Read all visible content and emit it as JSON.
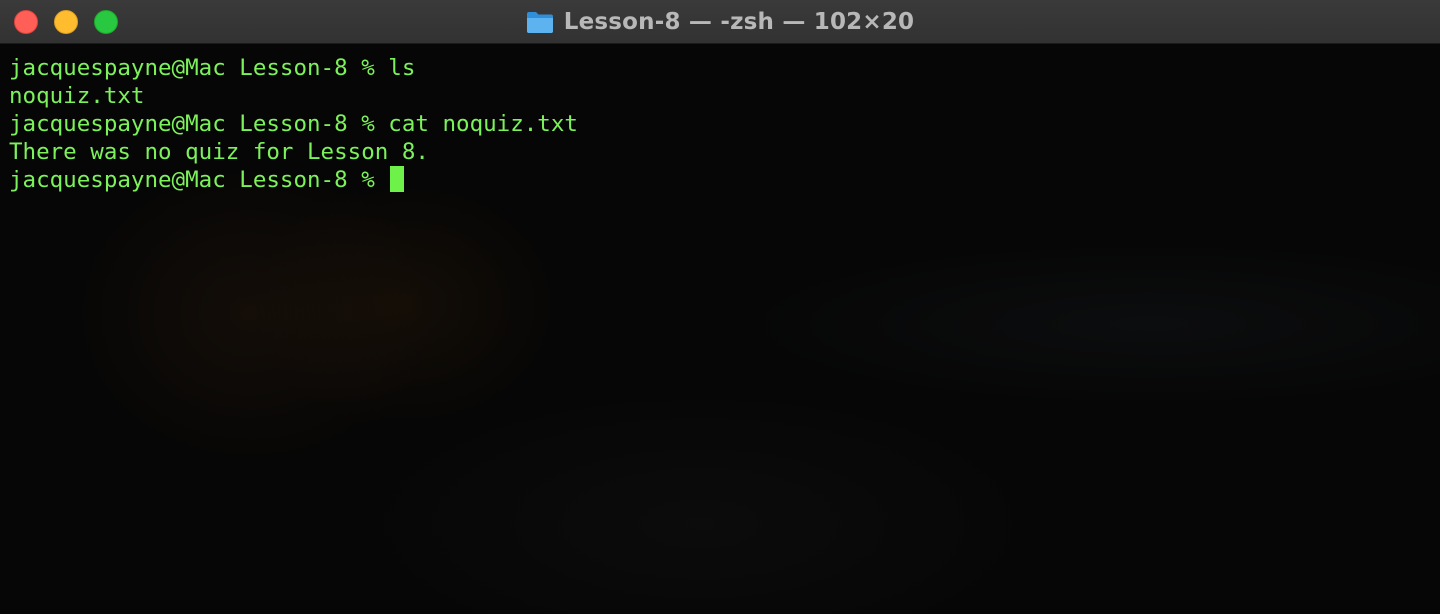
{
  "window": {
    "title": "Lesson-8 — -zsh — 102×20",
    "title_icon": "folder-icon",
    "controls": {
      "close": "close-icon",
      "minimize": "minimize-icon",
      "zoom": "zoom-icon"
    }
  },
  "terminal": {
    "lines": [
      "jacquespayne@Mac Lesson-8 % ls",
      "noquiz.txt",
      "jacquespayne@Mac Lesson-8 % cat noquiz.txt",
      "There was no quiz for Lesson 8.",
      "jacquespayne@Mac Lesson-8 % "
    ]
  },
  "colors": {
    "text": "#7cf25a",
    "cursor": "#6ef24a",
    "background": "#060606",
    "titlebar": "#363636",
    "close": "#ff5f57",
    "minimize": "#febc2e",
    "zoom": "#28c840"
  }
}
